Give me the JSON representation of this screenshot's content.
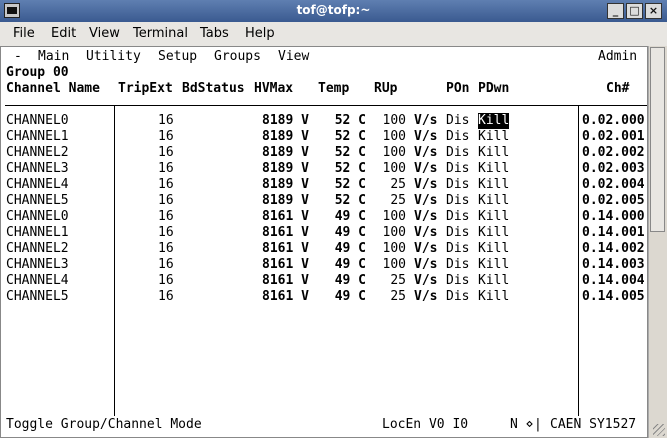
{
  "window": {
    "title": "tof@tofp:~"
  },
  "menubar": [
    "File",
    "Edit",
    "View",
    "Terminal",
    "Tabs",
    "Help"
  ],
  "app_menu": {
    "dash": "-",
    "items": [
      "Main",
      "Utility",
      "Setup",
      "Groups",
      "View"
    ],
    "user": "Admin"
  },
  "group_label": "Group 00",
  "columns": [
    "Channel Name",
    "TripExt",
    "BdStatus",
    "HVMax",
    "Temp",
    "RUp",
    "POn",
    "PDwn",
    "Ch#"
  ],
  "rows": [
    {
      "name": "CHANNEL0",
      "trip": "16",
      "hvmax": "8189 V",
      "temp": "52 C",
      "rup": "100",
      "rup_unit": "V/s",
      "pon": "Dis",
      "pdwn": "Kill",
      "ch": "0.02.000"
    },
    {
      "name": "CHANNEL1",
      "trip": "16",
      "hvmax": "8189 V",
      "temp": "52 C",
      "rup": "100",
      "rup_unit": "V/s",
      "pon": "Dis",
      "pdwn": "Kill",
      "ch": "0.02.001"
    },
    {
      "name": "CHANNEL2",
      "trip": "16",
      "hvmax": "8189 V",
      "temp": "52 C",
      "rup": "100",
      "rup_unit": "V/s",
      "pon": "Dis",
      "pdwn": "Kill",
      "ch": "0.02.002"
    },
    {
      "name": "CHANNEL3",
      "trip": "16",
      "hvmax": "8189 V",
      "temp": "52 C",
      "rup": "100",
      "rup_unit": "V/s",
      "pon": "Dis",
      "pdwn": "Kill",
      "ch": "0.02.003"
    },
    {
      "name": "CHANNEL4",
      "trip": "16",
      "hvmax": "8189 V",
      "temp": "52 C",
      "rup": "25",
      "rup_unit": "V/s",
      "pon": "Dis",
      "pdwn": "Kill",
      "ch": "0.02.004"
    },
    {
      "name": "CHANNEL5",
      "trip": "16",
      "hvmax": "8189 V",
      "temp": "52 C",
      "rup": "25",
      "rup_unit": "V/s",
      "pon": "Dis",
      "pdwn": "Kill",
      "ch": "0.02.005"
    },
    {
      "name": "CHANNEL0",
      "trip": "16",
      "hvmax": "8161 V",
      "temp": "49 C",
      "rup": "100",
      "rup_unit": "V/s",
      "pon": "Dis",
      "pdwn": "Kill",
      "ch": "0.14.000"
    },
    {
      "name": "CHANNEL1",
      "trip": "16",
      "hvmax": "8161 V",
      "temp": "49 C",
      "rup": "100",
      "rup_unit": "V/s",
      "pon": "Dis",
      "pdwn": "Kill",
      "ch": "0.14.001"
    },
    {
      "name": "CHANNEL2",
      "trip": "16",
      "hvmax": "8161 V",
      "temp": "49 C",
      "rup": "100",
      "rup_unit": "V/s",
      "pon": "Dis",
      "pdwn": "Kill",
      "ch": "0.14.002"
    },
    {
      "name": "CHANNEL3",
      "trip": "16",
      "hvmax": "8161 V",
      "temp": "49 C",
      "rup": "100",
      "rup_unit": "V/s",
      "pon": "Dis",
      "pdwn": "Kill",
      "ch": "0.14.003"
    },
    {
      "name": "CHANNEL4",
      "trip": "16",
      "hvmax": "8161 V",
      "temp": "49 C",
      "rup": "25",
      "rup_unit": "V/s",
      "pon": "Dis",
      "pdwn": "Kill",
      "ch": "0.14.004"
    },
    {
      "name": "CHANNEL5",
      "trip": "16",
      "hvmax": "8161 V",
      "temp": "49 C",
      "rup": "25",
      "rup_unit": "V/s",
      "pon": "Dis",
      "pdwn": "Kill",
      "ch": "0.14.005"
    }
  ],
  "status": {
    "hint": "Toggle Group/Channel Mode",
    "mode": "LocEn V0 I0",
    "n": "N ⋄",
    "sep": "|",
    "model": "CAEN SY1527"
  }
}
